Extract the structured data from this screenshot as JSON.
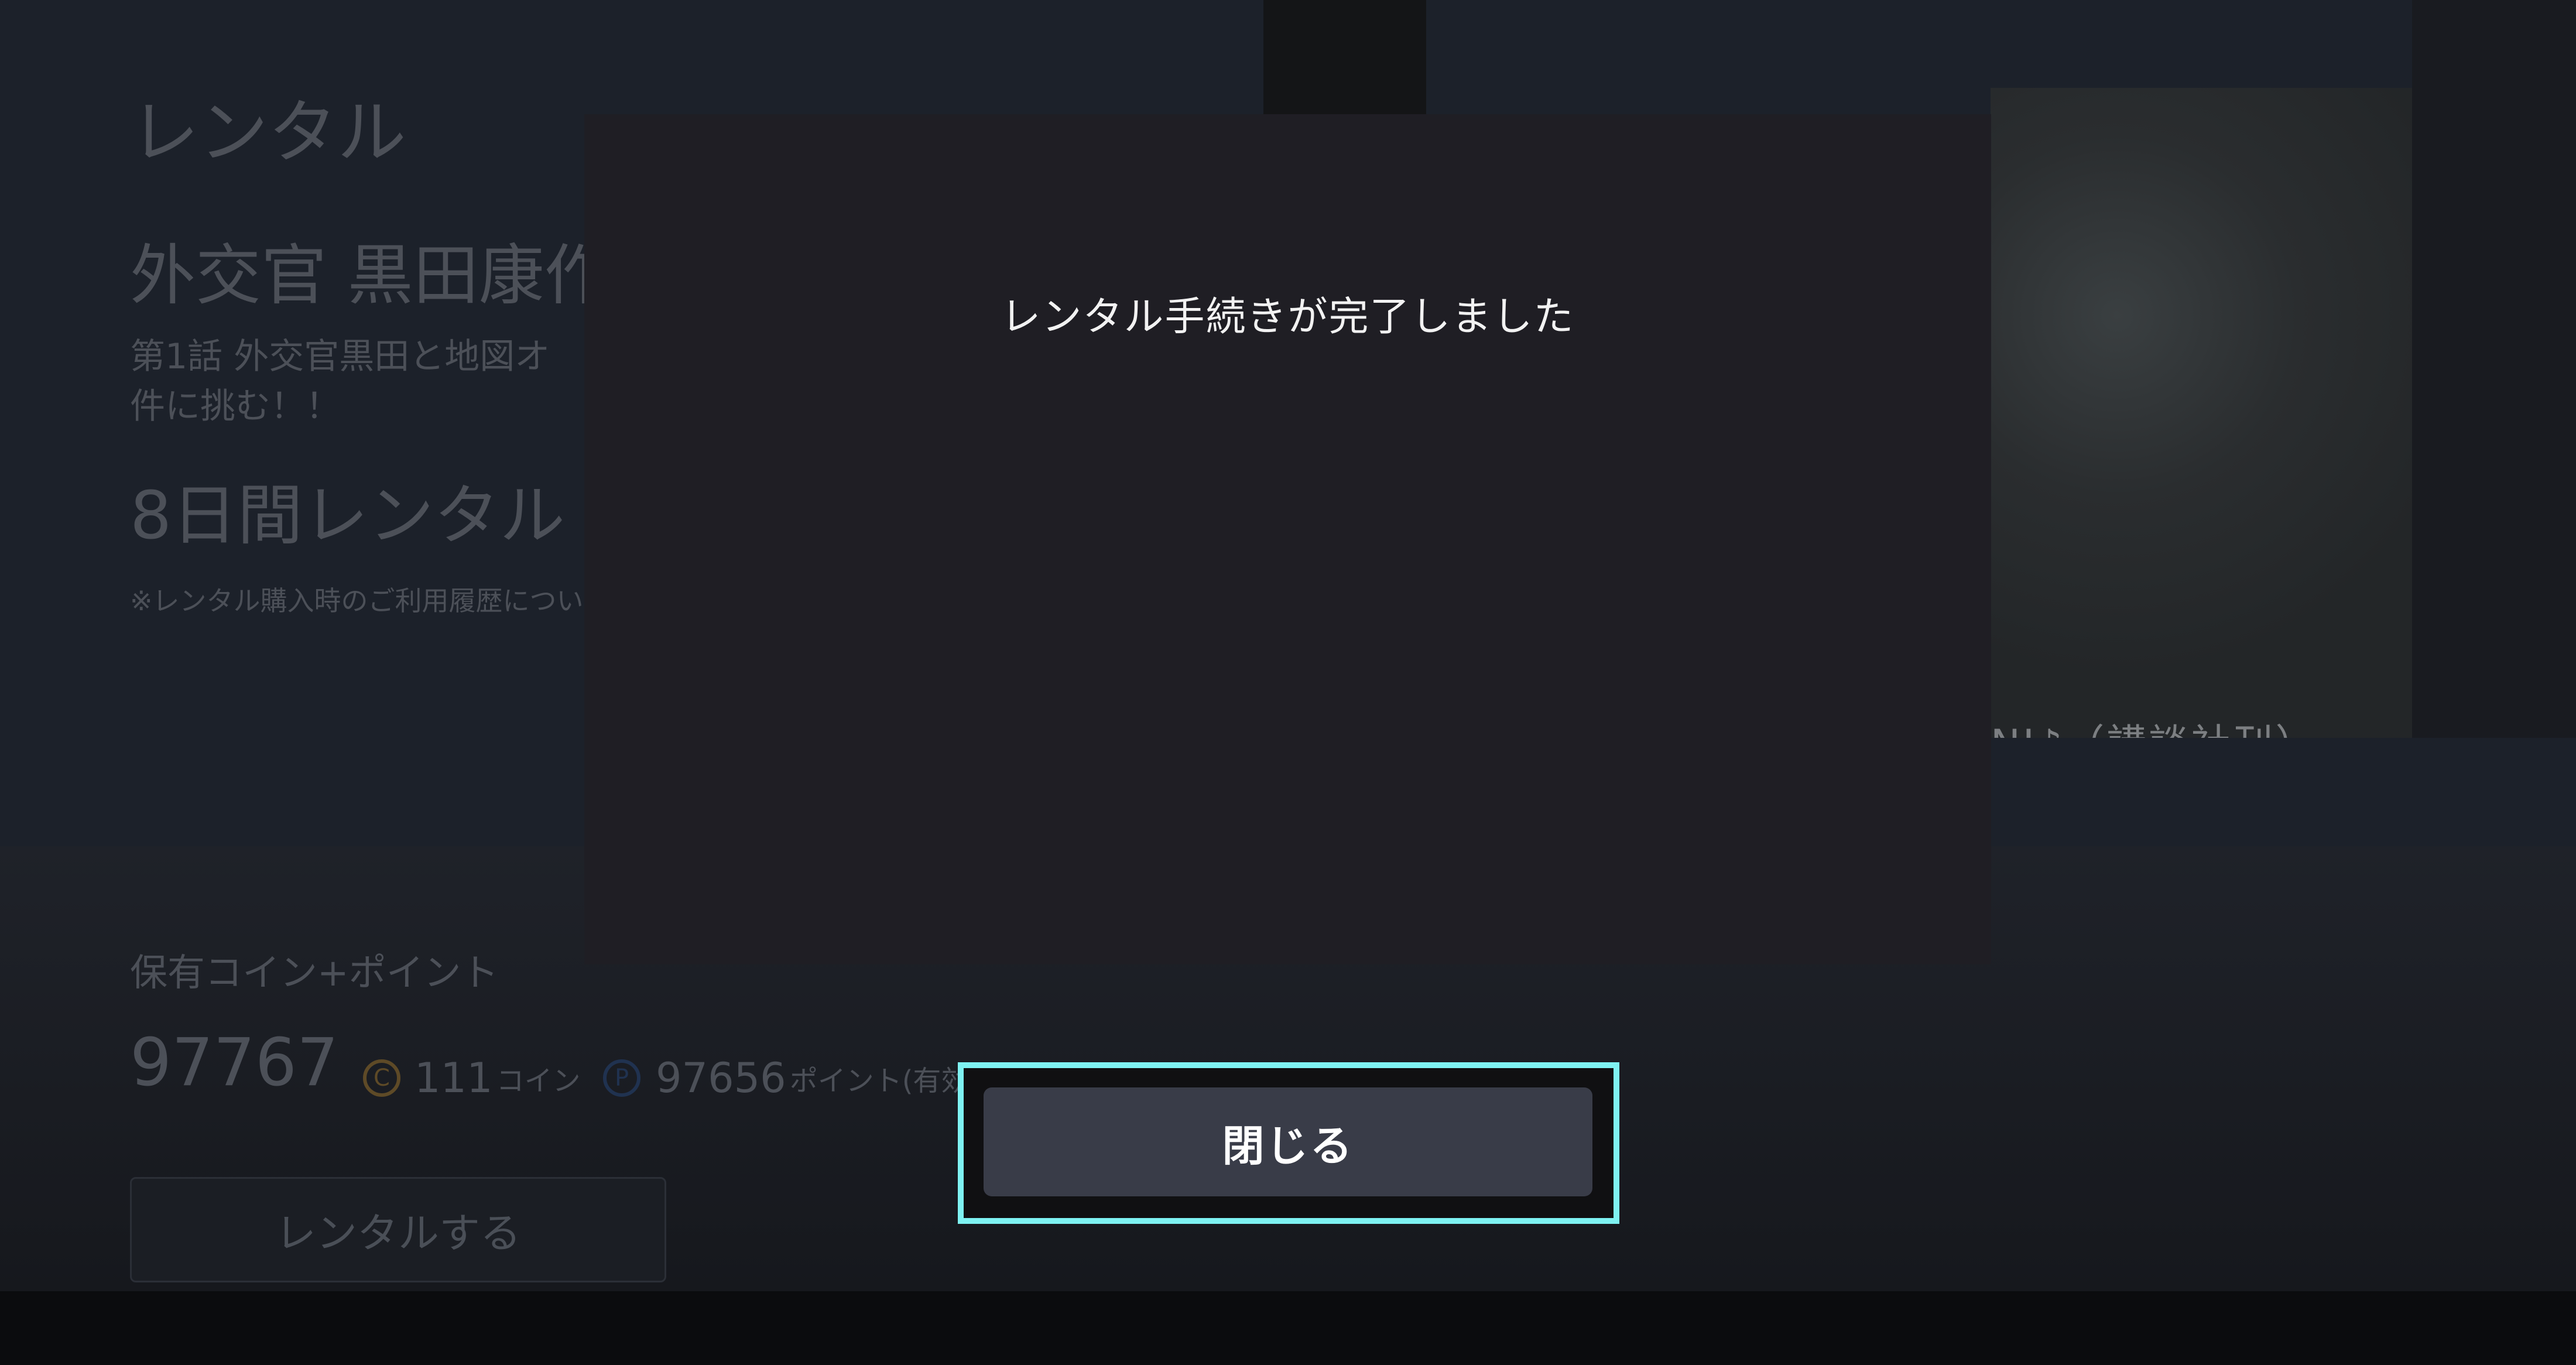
{
  "background": {
    "page_title": "レンタル",
    "series_title": "外交官 黒田康作",
    "episode_line1": "第1話 外交官黒田と地図オ",
    "episode_line2": "件に挑む！！",
    "rental_period": "8日間レンタル",
    "note": "※レンタル購入時のご利用履歴につい",
    "thumbnail_caption": "NI♪（講談社刊）",
    "holdings_label": "保有コイン+ポイント",
    "holdings_total": "97767",
    "coins": {
      "icon": "coin-icon",
      "glyph": "C",
      "value": "111",
      "unit": "コイン"
    },
    "points": {
      "icon": "point-icon",
      "glyph": "P",
      "value": "97656",
      "unit": "ポイント(有効期限あり)"
    },
    "rent_button_label": "レンタルする"
  },
  "dialog": {
    "message": "レンタル手続きが完了しました",
    "close_label": "閉じる"
  },
  "colors": {
    "focus_ring": "#7ef2f2",
    "dialog_bg": "#1f1e24",
    "button_bg": "#393c48"
  }
}
